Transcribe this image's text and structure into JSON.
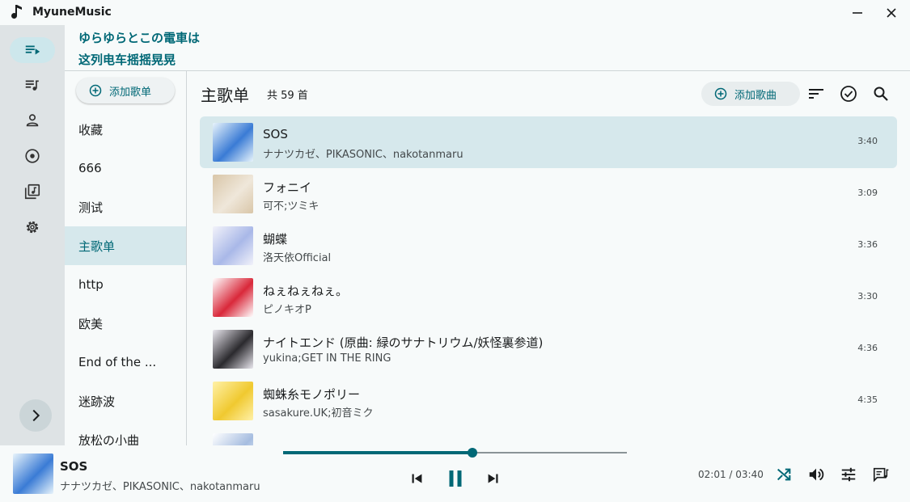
{
  "app": {
    "title": "MyuneMusic"
  },
  "lyrics": {
    "line1": "ゆらゆらとこの電車は",
    "line2": "这列电车摇摇晃晃"
  },
  "playlists": {
    "add_label": "添加歌单",
    "items": [
      {
        "label": "收藏"
      },
      {
        "label": "666"
      },
      {
        "label": "测试"
      },
      {
        "label": "主歌单"
      },
      {
        "label": "http"
      },
      {
        "label": "欧美"
      },
      {
        "label": "End of the ..."
      },
      {
        "label": "迷跡波"
      },
      {
        "label": "放松の小曲"
      }
    ],
    "active_index": 3
  },
  "main": {
    "title": "主歌单",
    "count": "共 59 首",
    "add_song_label": "添加歌曲",
    "songs": [
      {
        "title": "SOS",
        "artist": "ナナツカゼ、PIKASONIC、nakotanmaru",
        "duration": "3:40",
        "cover_color": "#3a7bd5",
        "cover_color2": "#e8f4fb"
      },
      {
        "title": "フォニイ",
        "artist": "可不;ツミキ",
        "duration": "3:09",
        "cover_color": "#efe7da",
        "cover_color2": "#d9c6a8"
      },
      {
        "title": "蝴蝶",
        "artist": "洛天依Official",
        "duration": "3:36",
        "cover_color": "#a9b8e8",
        "cover_color2": "#f2f2fa"
      },
      {
        "title": "ねぇねぇねぇ。",
        "artist": "ピノキオP",
        "duration": "3:30",
        "cover_color": "#d9283a",
        "cover_color2": "#ffffff"
      },
      {
        "title": "ナイトエンド (原曲: 緑のサナトリウム/妖怪裏参道)",
        "artist": "yukina;GET IN THE RING",
        "duration": "4:36",
        "cover_color": "#2b2a2e",
        "cover_color2": "#e9e7ee"
      },
      {
        "title": "蜘蛛糸モノポリー",
        "artist": "sasakure.UK;初音ミク",
        "duration": "4:35",
        "cover_color": "#f0c930",
        "cover_color2": "#fff1a8"
      },
      {
        "title": "",
        "artist": "",
        "duration": "",
        "cover_color": "#a6bde0",
        "cover_color2": "#ffffff"
      }
    ],
    "active_index": 0
  },
  "player": {
    "title": "SOS",
    "artist": "ナナツカゼ、PIKASONIC、nakotanmaru",
    "elapsed_and_total": "02:01 / 03:40",
    "progress": 0.55
  },
  "colors": {
    "accent": "#006876",
    "active_bg": "#d6e8ec",
    "rail_bg": "#dee3e5"
  },
  "icons": {
    "rail": [
      "queue-music-icon",
      "playlist-icon",
      "person-icon",
      "album-icon",
      "library-music-icon",
      "settings-icon"
    ],
    "toolbar": [
      "sort-icon",
      "select-check-icon",
      "search-icon"
    ],
    "player": [
      "skip-previous-icon",
      "pause-icon",
      "skip-next-icon",
      "shuffle-icon",
      "volume-icon",
      "equalizer-icon",
      "lyrics-icon"
    ]
  }
}
